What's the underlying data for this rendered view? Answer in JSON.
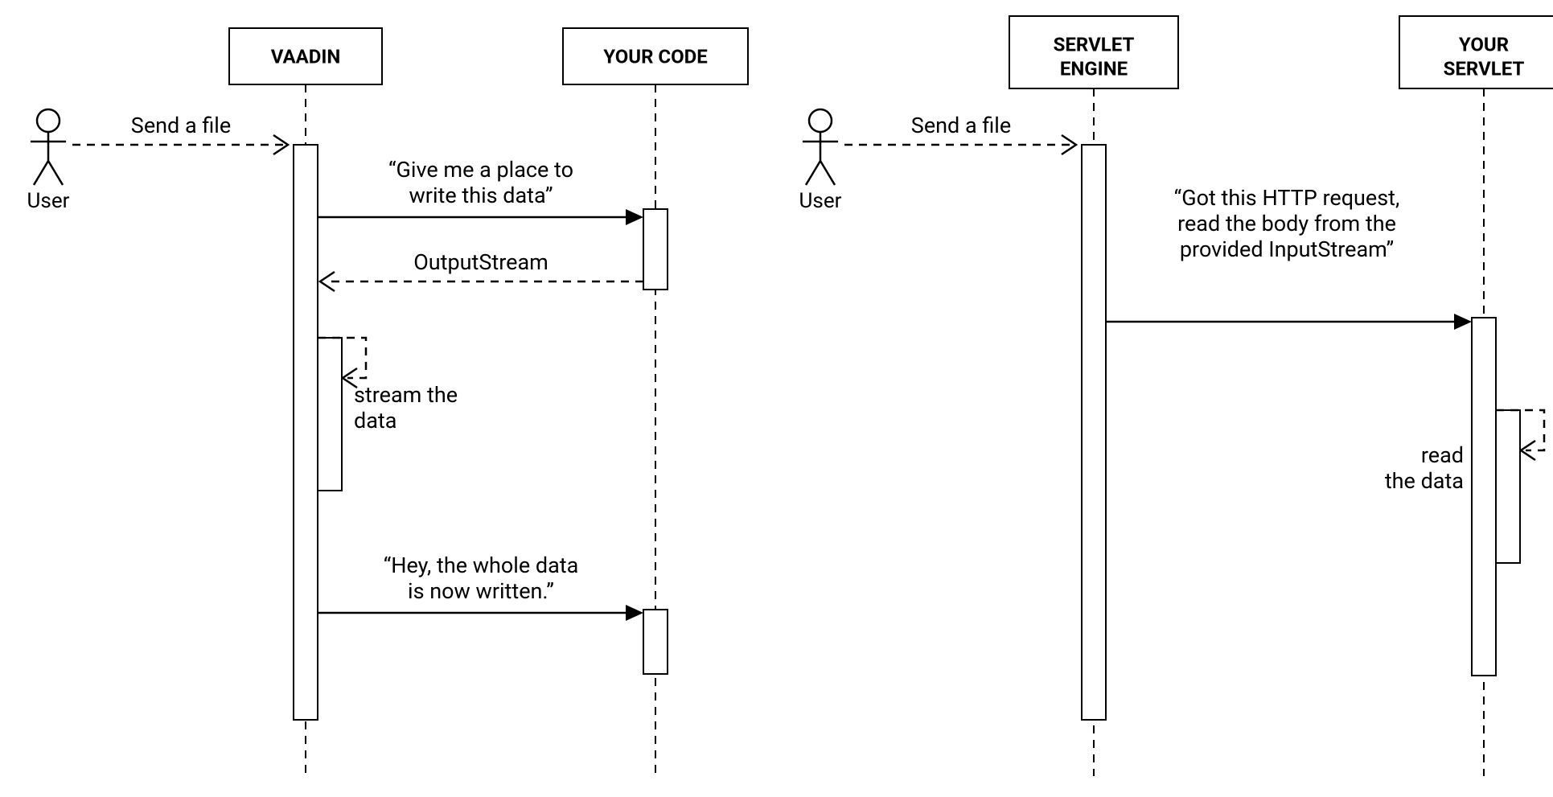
{
  "diagram1": {
    "actor": {
      "label": "User"
    },
    "participants": {
      "vaadin": {
        "label": "VAADIN"
      },
      "yourcode": {
        "label": "YOUR CODE"
      }
    },
    "messages": {
      "sendFile": "Send a file",
      "givePlace1": "“Give me a place to",
      "givePlace2": "write this data”",
      "outputStream": "OutputStream",
      "stream1": "stream the",
      "stream2": "data",
      "written1": "“Hey, the whole data",
      "written2": "is now written.”"
    }
  },
  "diagram2": {
    "actor": {
      "label": "User"
    },
    "participants": {
      "servletEngine1": "SERVLET",
      "servletEngine2": "ENGINE",
      "yourServlet1": "YOUR",
      "yourServlet2": "SERVLET"
    },
    "messages": {
      "sendFile": "Send a file",
      "gotRequest1": "“Got this HTTP request,",
      "gotRequest2": "read the body from the",
      "gotRequest3": "provided InputStream”",
      "read1": "read",
      "read2": "the data"
    }
  }
}
